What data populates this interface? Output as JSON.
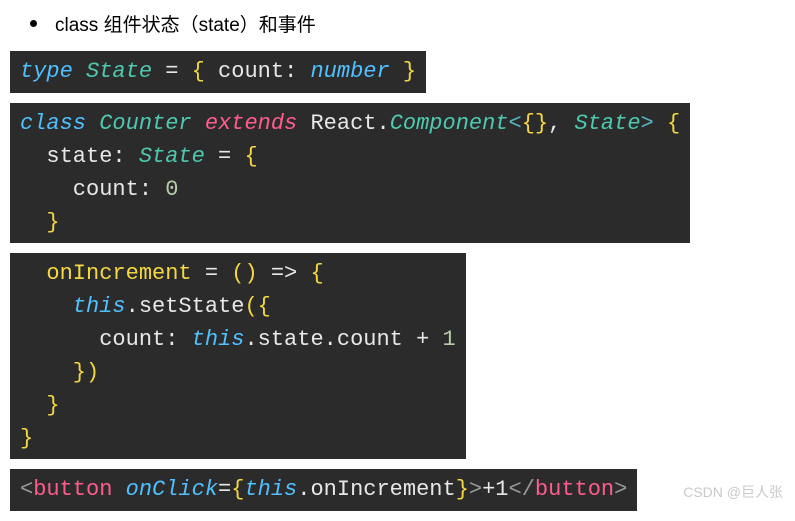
{
  "bullet": {
    "text": "class 组件状态（state）和事件"
  },
  "code1": {
    "type_kw": "type",
    "state_name": "State",
    "eq": " = ",
    "lbrace": "{",
    "field": " count",
    "colon": ": ",
    "num_type": "number",
    "rbrace": " }"
  },
  "code2": {
    "class_kw": "class",
    "counter": " Counter ",
    "extends_kw": "extends",
    "react": " React",
    "dot": ".",
    "component": "Component",
    "lt": "<",
    "empty": "{}",
    "comma": ", ",
    "state_ref": "State",
    "gt": ">",
    "space_lbrace": " {",
    "line2_state": "  state",
    "line2_colon": ": ",
    "line2_type": "State",
    "line2_eq": " = ",
    "line2_lbrace": "{",
    "line3_count": "    count",
    "line3_colon": ": ",
    "line3_zero": "0",
    "line4_rbrace": "  }"
  },
  "code3": {
    "fn_name": "  onIncrement",
    "eq": " = ",
    "parens": "()",
    "arrow": " => ",
    "lbrace": "{",
    "this1": "    this",
    "dot1": ".",
    "setstate": "setState",
    "lparen": "(",
    "obj_l": "{",
    "count": "      count",
    "colon": ": ",
    "this2": "this",
    "dot2": ".",
    "state_word": "state",
    "dot3": ".",
    "count2": "count",
    "plus": " + ",
    "one": "1",
    "obj_r": "    }",
    "rparen": ")",
    "rbrace1": "  }",
    "rbrace2": "}"
  },
  "code4": {
    "lt1": "<",
    "tag1": "button",
    "space": " ",
    "onclick_attr": "onClick",
    "eq": "=",
    "expr_l": "{",
    "this_kw": "this",
    "dot": ".",
    "method": "onIncrement",
    "expr_r": "}",
    "gt1": ">",
    "text": "+1",
    "lt2": "</",
    "tag2": "button",
    "gt2": ">"
  },
  "watermark": "CSDN @巨人张"
}
